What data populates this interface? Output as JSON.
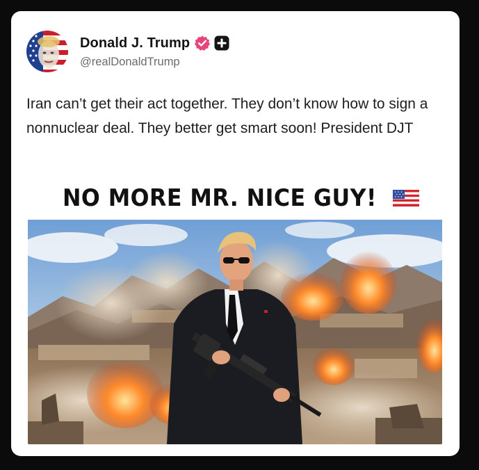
{
  "post": {
    "author": {
      "display_name": "Donald J. Trump",
      "handle": "@realDonaldTrump",
      "avatar_icon": "avatar-flag-portrait",
      "verified_icon": "verified-badge-icon",
      "verified_color": "#e8457a",
      "extra_badge_icon": "plus-badge-icon"
    },
    "text": "Iran can’t get their act together. They don’t know how to sign a nonnuclear deal. They better get smart soon! President DJT",
    "media": {
      "headline": "NO MORE MR. NICE GUY!",
      "headline_emoji": "us-flag-emoji"
    }
  },
  "colors": {
    "page_background": "#0b0b0c",
    "card_background": "#ffffff",
    "name_text": "#141414",
    "handle_text": "#6b6b6b",
    "body_text": "#1d1d1d"
  }
}
